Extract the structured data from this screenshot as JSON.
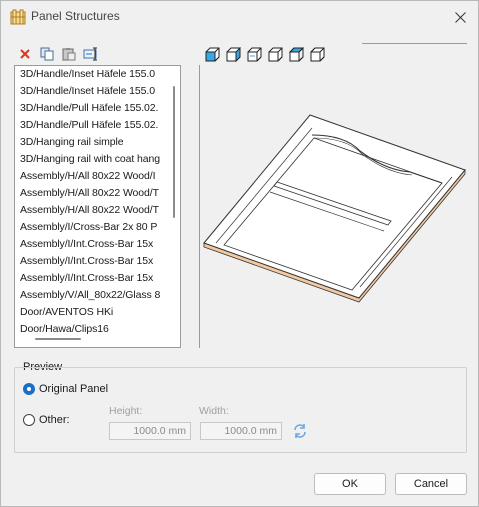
{
  "window": {
    "title": "Panel Structures"
  },
  "structures": {
    "items": [
      "3D/Handle/Inset Häfele 155.0",
      "3D/Handle/Inset Häfele 155.0",
      "3D/Handle/Pull Häfele 155.02.",
      "3D/Handle/Pull Häfele 155.02.",
      "3D/Hanging rail simple",
      "3D/Hanging rail with coat hang",
      "Assembly/H/All 80x22 Wood/I",
      "Assembly/H/All 80x22 Wood/T",
      "Assembly/H/All 80x22 Wood/T",
      "Assembly/I/Cross-Bar 2x 80 P",
      "Assembly/I/Int.Cross-Bar 15x",
      "Assembly/I/Int.Cross-Bar 15x",
      "Assembly/I/Int.Cross-Bar 15x",
      "Assembly/V/All_80x22/Glass 8",
      "Door/AVENTOS HKi",
      "Door/Hawa/Clips16"
    ]
  },
  "preview": {
    "group_label": "Preview",
    "original_label": "Original Panel",
    "other_label": "Other:",
    "height_label": "Height:",
    "width_label": "Width:",
    "height_value": "1000.0 mm",
    "width_value": "1000.0 mm",
    "selected": "original"
  },
  "buttons": {
    "ok": "OK",
    "cancel": "Cancel"
  },
  "colors": {
    "accent": "#1b6fc4",
    "delete": "#d9391e",
    "panel_edge": "#f2c9a0"
  }
}
